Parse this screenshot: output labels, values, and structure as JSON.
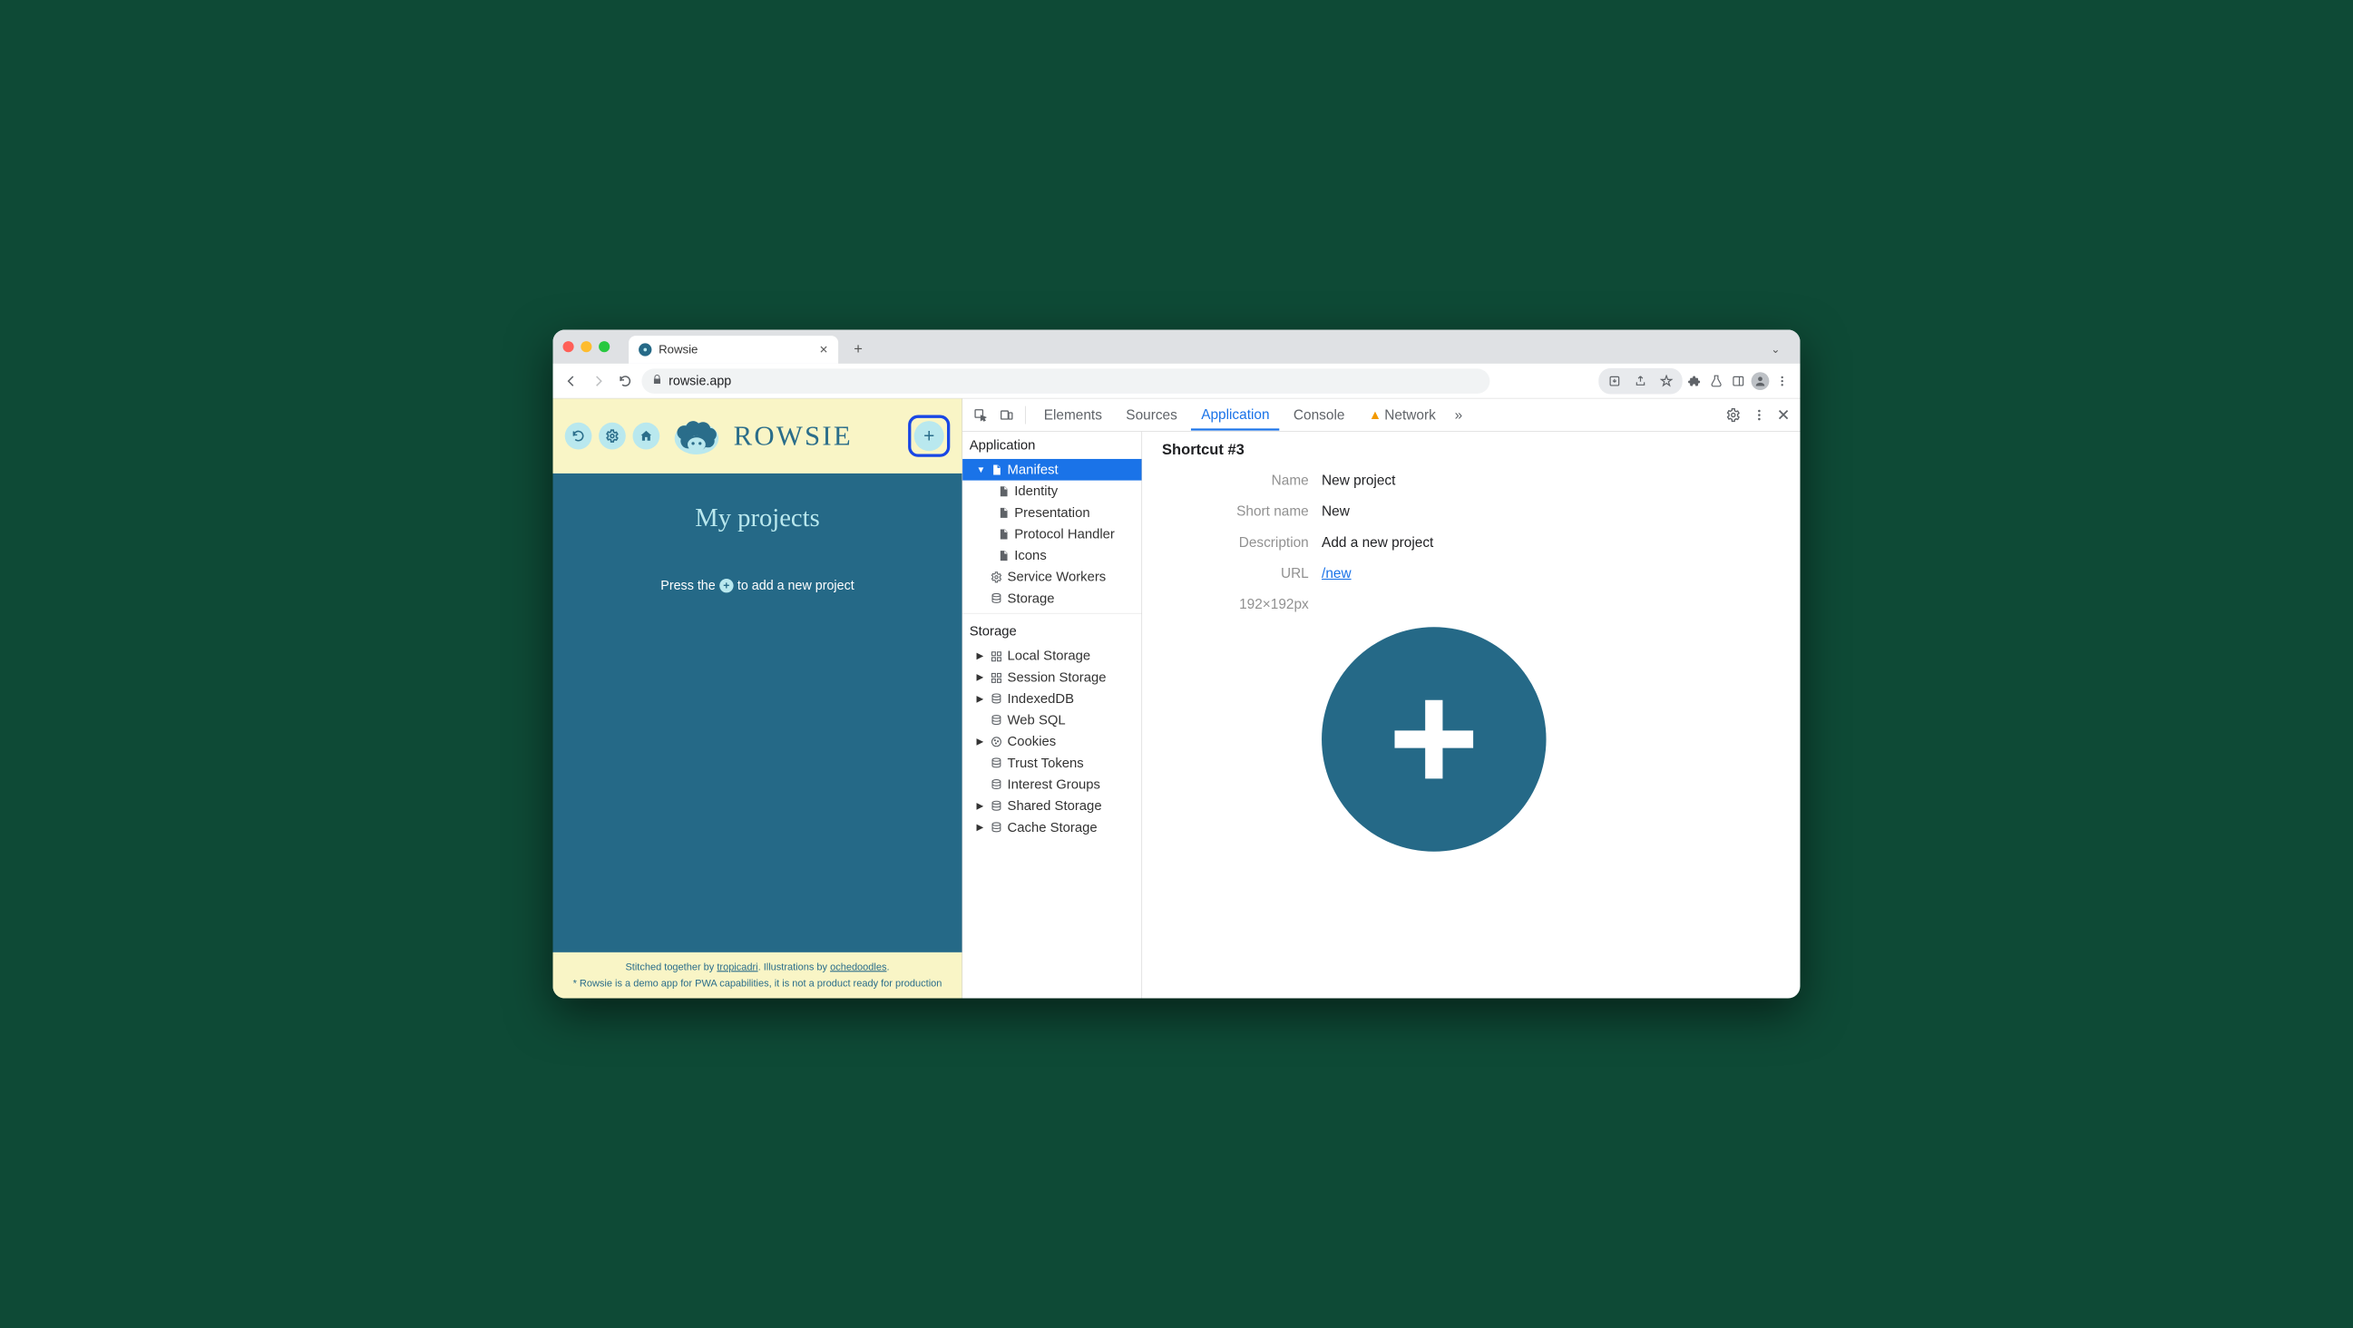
{
  "browser": {
    "tab_title": "Rowsie",
    "url": "rowsie.app"
  },
  "app": {
    "logo_text": "ROWSIE",
    "heading": "My projects",
    "hint_before": "Press the",
    "hint_after": "to add a new project",
    "footer_line1_a": "Stitched together by ",
    "footer_link1": "tropicadri",
    "footer_line1_b": ". Illustrations by ",
    "footer_link2": "ochedoodles",
    "footer_line1_c": ".",
    "footer_line2": "* Rowsie is a demo app for PWA capabilities, it is not a product ready for production"
  },
  "devtools": {
    "tabs": {
      "elements": "Elements",
      "sources": "Sources",
      "application": "Application",
      "console": "Console",
      "network": "Network",
      "more": "»"
    },
    "side": {
      "group1": "Application",
      "manifest": "Manifest",
      "identity": "Identity",
      "presentation": "Presentation",
      "protocol": "Protocol Handler",
      "icons": "Icons",
      "service_workers": "Service Workers",
      "storage": "Storage",
      "group2": "Storage",
      "local": "Local Storage",
      "session": "Session Storage",
      "indexed": "IndexedDB",
      "websql": "Web SQL",
      "cookies": "Cookies",
      "trust": "Trust Tokens",
      "interest": "Interest Groups",
      "shared": "Shared Storage",
      "cache": "Cache Storage"
    },
    "detail": {
      "title": "Shortcut #3",
      "name_k": "Name",
      "name_v": "New project",
      "short_k": "Short name",
      "short_v": "New",
      "desc_k": "Description",
      "desc_v": "Add a new project",
      "url_k": "URL",
      "url_v": "/new",
      "size": "192×192px"
    }
  }
}
